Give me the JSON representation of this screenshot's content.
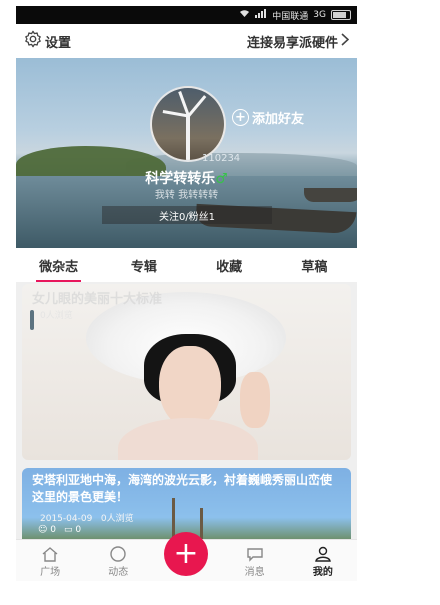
{
  "status_bar": {
    "carrier": "中国联通",
    "network": "3G"
  },
  "top_bar": {
    "settings_label": "设置",
    "connect_label": "连接易享派硬件"
  },
  "profile": {
    "user_id": "110234",
    "username": "科学转转乐",
    "gender_symbol": "♂",
    "tagline": "我转  我转转转",
    "add_friend": "添加好友",
    "follow_stats": "关注0/粉丝1"
  },
  "tabs": [
    {
      "label": "微杂志"
    },
    {
      "label": "专辑"
    },
    {
      "label": "收藏"
    },
    {
      "label": "草稿"
    }
  ],
  "feed": [
    {
      "title": "女儿眼的美丽十大标准",
      "date": "",
      "views": "0人浏览"
    },
    {
      "title": "安塔利亚地中海，海湾的波光云影，衬着巍峨秀丽山峦使这里的景色更美！",
      "date": "2015-04-09",
      "views": "0人浏览",
      "likes": "0",
      "comments": "0"
    }
  ],
  "bottom_nav": [
    {
      "label": "广场"
    },
    {
      "label": "动态"
    },
    {
      "label": "+"
    },
    {
      "label": "消息"
    },
    {
      "label": "我的"
    }
  ],
  "colors": {
    "accent": "#e8174f",
    "tab_underline": "#e8175d",
    "gender": "#37c24a"
  }
}
